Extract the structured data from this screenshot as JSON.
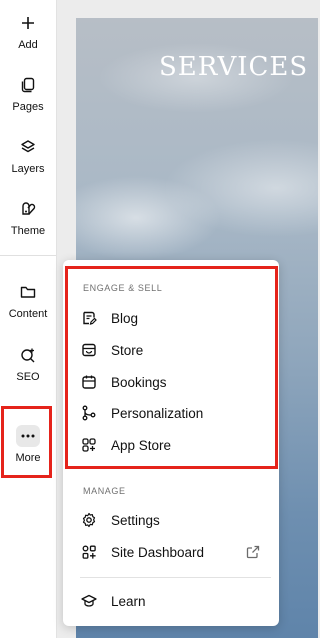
{
  "sidebar": {
    "items": [
      {
        "label": "Add",
        "icon": "plus-icon"
      },
      {
        "label": "Pages",
        "icon": "pages-icon"
      },
      {
        "label": "Layers",
        "icon": "layers-icon"
      },
      {
        "label": "Theme",
        "icon": "theme-icon"
      },
      {
        "label": "Content",
        "icon": "folder-icon"
      },
      {
        "label": "SEO",
        "icon": "seo-search-icon"
      },
      {
        "label": "More",
        "icon": "ellipsis-icon"
      }
    ]
  },
  "canvas": {
    "title": "SERVICES"
  },
  "menu": {
    "engage_label": "ENGAGE & SELL",
    "engage_items": [
      {
        "label": "Blog",
        "icon": "blog-icon"
      },
      {
        "label": "Store",
        "icon": "store-icon"
      },
      {
        "label": "Bookings",
        "icon": "calendar-icon"
      },
      {
        "label": "Personalization",
        "icon": "personalization-icon"
      },
      {
        "label": "App Store",
        "icon": "app-store-icon"
      }
    ],
    "manage_label": "MANAGE",
    "manage_items": [
      {
        "label": "Settings",
        "icon": "gear-icon"
      },
      {
        "label": "Site Dashboard",
        "icon": "dashboard-icon",
        "trailing_icon": "external-link-icon"
      }
    ],
    "learn_item": {
      "label": "Learn",
      "icon": "graduation-cap-icon"
    }
  },
  "colors": {
    "highlight": "#e5231b",
    "text": "#111111",
    "muted": "#707070"
  }
}
